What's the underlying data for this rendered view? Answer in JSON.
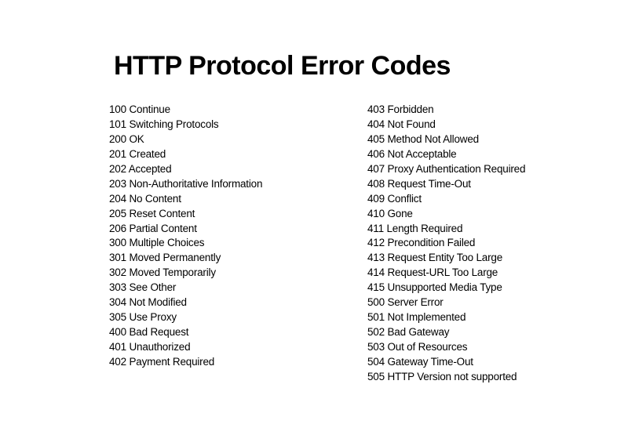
{
  "title": "HTTP Protocol Error Codes",
  "left_codes": [
    "100 Continue",
    "101 Switching Protocols",
    "200 OK",
    "201 Created",
    "202 Accepted",
    "203 Non-Authoritative Information",
    "204 No Content",
    "205 Reset Content",
    "206 Partial Content",
    "300 Multiple Choices",
    "301 Moved Permanently",
    "302 Moved Temporarily",
    "303 See Other",
    "304 Not Modified",
    "305 Use Proxy",
    "400 Bad Request",
    "401 Unauthorized",
    "402 Payment Required"
  ],
  "right_codes": [
    "403 Forbidden",
    "404 Not Found",
    "405 Method Not Allowed",
    "406 Not Acceptable",
    "407 Proxy Authentication Required",
    "408 Request Time-Out",
    "409 Conflict",
    "410 Gone",
    "411 Length Required",
    "412 Precondition Failed",
    "413 Request Entity Too Large",
    "414 Request-URL Too Large",
    "415 Unsupported Media Type",
    "500 Server Error",
    "501 Not Implemented",
    "502 Bad Gateway",
    "503 Out of Resources",
    "504 Gateway Time-Out",
    "505 HTTP Version not supported"
  ]
}
